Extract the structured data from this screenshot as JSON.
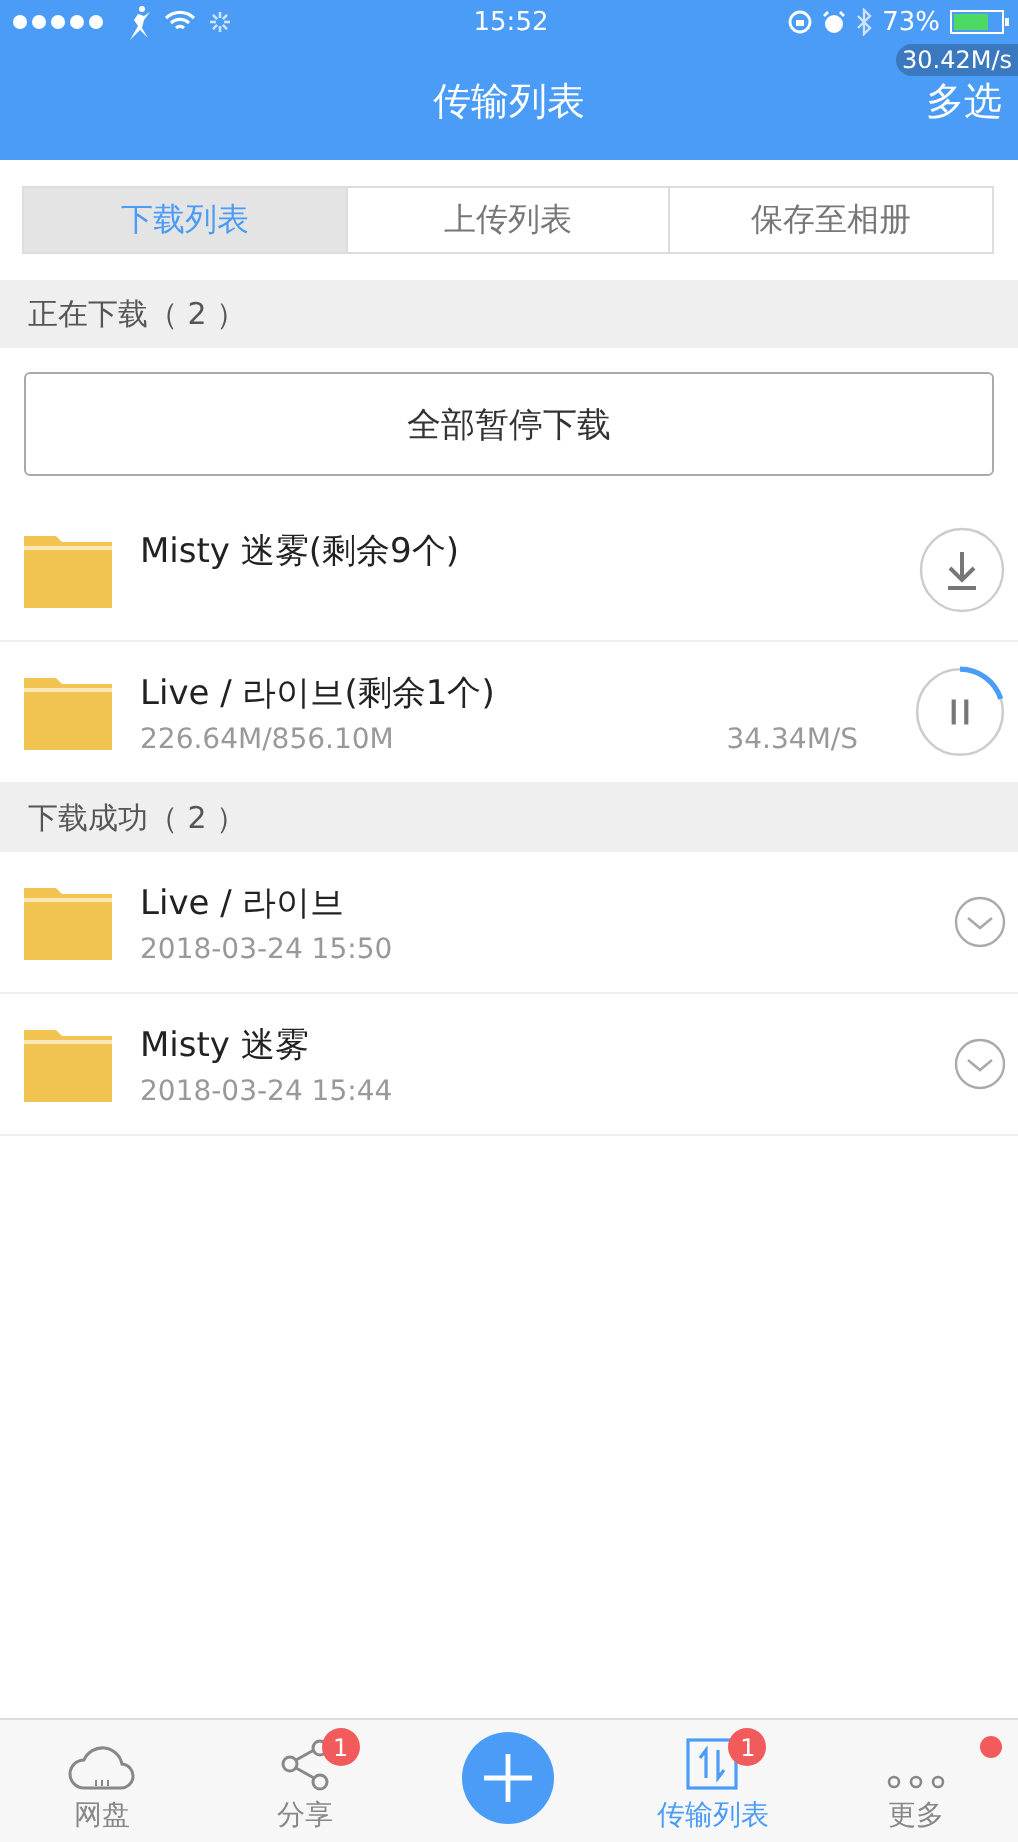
{
  "status_bar": {
    "time": "15:52",
    "battery_percent": "73%",
    "speed": "30.42M/s"
  },
  "nav": {
    "title": "传输列表",
    "action": "多选"
  },
  "tabs": [
    {
      "label": "下载列表",
      "selected": true
    },
    {
      "label": "上传列表",
      "selected": false
    },
    {
      "label": "保存至相册",
      "selected": false
    }
  ],
  "sections": [
    {
      "title": "正在下载（ 2 ）",
      "button": "全部暂停下载",
      "items": [
        {
          "name": "Misty 迷雾(剩余9个)",
          "kind": "waiting"
        },
        {
          "name": "Live / 라이브(剩余1个)",
          "kind": "downloading",
          "size": "226.64M/856.10M",
          "speed": "34.34M/S"
        }
      ]
    },
    {
      "title": "下载成功（ 2 ）",
      "items": [
        {
          "name": "Live / 라이브",
          "kind": "done",
          "date": "2018-03-24 15:50"
        },
        {
          "name": "Misty 迷雾",
          "kind": "done",
          "date": "2018-03-24 15:44"
        }
      ]
    }
  ],
  "tab_bar": [
    {
      "label": "网盘",
      "kind": "cloud",
      "selected": false
    },
    {
      "label": "分享",
      "kind": "share",
      "selected": false,
      "badge": "1"
    },
    {
      "kind": "add"
    },
    {
      "label": "传输列表",
      "kind": "transfer",
      "selected": true,
      "badge": "1"
    },
    {
      "label": "更多",
      "kind": "more",
      "selected": false,
      "dot": true
    }
  ]
}
